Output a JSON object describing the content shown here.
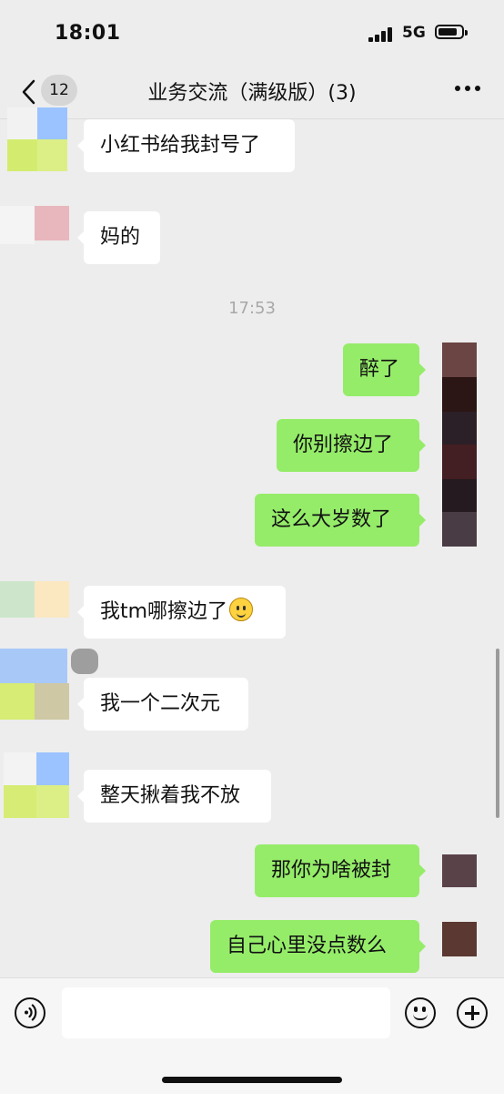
{
  "status_bar": {
    "time": "18:01",
    "network": "5G"
  },
  "nav": {
    "unread_count": "12",
    "title": "业务交流（满级版）(3)"
  },
  "chat": {
    "timestamp": "17:53",
    "messages": [
      {
        "side": "in",
        "text": "小红书给我封号了"
      },
      {
        "side": "in",
        "text": "妈的"
      },
      {
        "side": "out",
        "text": "醉了"
      },
      {
        "side": "out",
        "text": "你别擦边了"
      },
      {
        "side": "out",
        "text": "这么大岁数了"
      },
      {
        "side": "in",
        "text": "我tm哪擦边了",
        "emoji": "smile-emoji"
      },
      {
        "side": "in",
        "text": "我一个二次元"
      },
      {
        "side": "in",
        "text": "整天揪着我不放"
      },
      {
        "side": "out",
        "text": "那你为啥被封"
      },
      {
        "side": "out",
        "text": "自己心里没点数么"
      }
    ]
  },
  "input_bar": {
    "placeholder": ""
  },
  "icons": [
    "back-chevron-icon",
    "more-icon",
    "voice-icon",
    "emoji-icon",
    "plus-icon"
  ],
  "colors": {
    "background": "#ededed",
    "outgoing_bubble": "#95ec69",
    "incoming_bubble": "#ffffff"
  }
}
